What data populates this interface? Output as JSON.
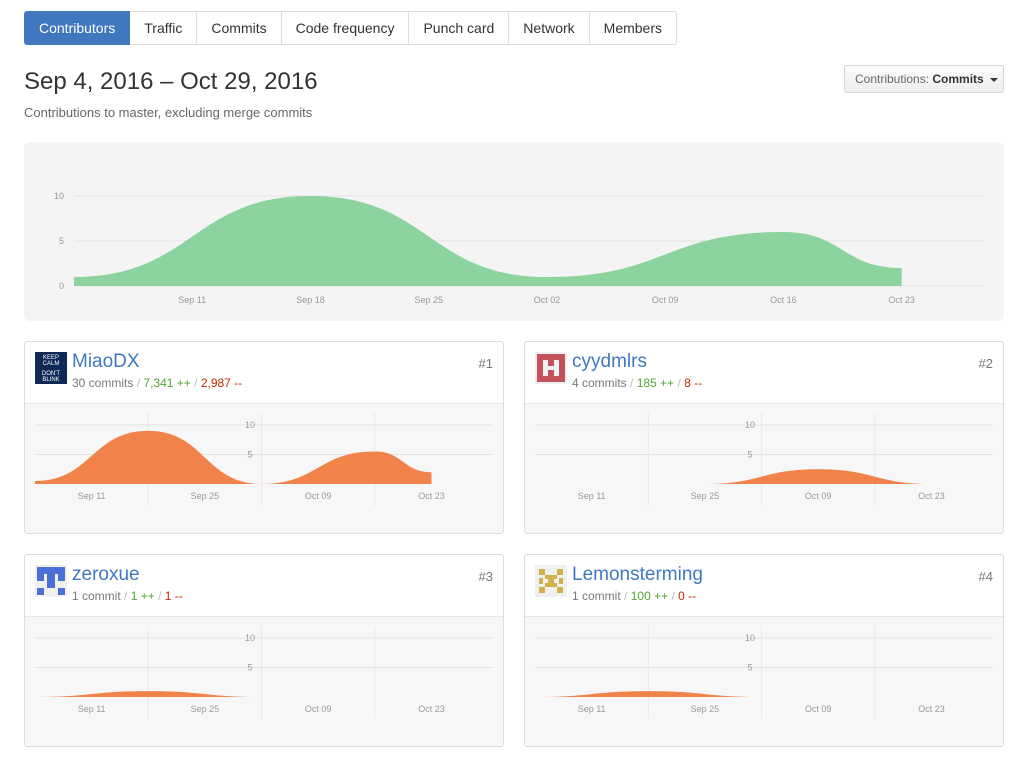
{
  "tabs": [
    {
      "label": "Contributors",
      "selected": true
    },
    {
      "label": "Traffic",
      "selected": false
    },
    {
      "label": "Commits",
      "selected": false
    },
    {
      "label": "Code frequency",
      "selected": false
    },
    {
      "label": "Punch card",
      "selected": false
    },
    {
      "label": "Network",
      "selected": false
    },
    {
      "label": "Members",
      "selected": false
    }
  ],
  "header": {
    "date_range": "Sep 4, 2016 – Oct 29, 2016",
    "subtitle": "Contributions to master, excluding merge commits"
  },
  "dropdown": {
    "prefix": "Contributions:",
    "value": "Commits"
  },
  "colors": {
    "main_area": "#8cd3a0",
    "user_area": "#f1834a",
    "link": "#4078c0",
    "additions": "#55a532",
    "deletions": "#bd2c00"
  },
  "main_chart_data": {
    "type": "area",
    "x": [
      "2016-09-04",
      "2016-09-18",
      "2016-10-02",
      "2016-10-16",
      "2016-10-23"
    ],
    "y": [
      1,
      10,
      1,
      6,
      2
    ],
    "ylim": [
      0,
      10
    ],
    "y_ticks": [
      "0",
      "5",
      "10"
    ],
    "x_ticks": [
      "Sep 11",
      "Sep 18",
      "Sep 25",
      "Oct 02",
      "Oct 09",
      "Oct 16",
      "Oct 23"
    ]
  },
  "contributors": [
    {
      "name": "MiaoDX",
      "rank": "#1",
      "commits": "30 commits",
      "additions": "7,341 ++",
      "deletions": "2,987 --",
      "avatar": "keep-calm-dont-blink-icon",
      "avatar_text": [
        "KEEP",
        "CALM",
        "DON'T",
        "BLINK"
      ],
      "chart_data": {
        "type": "area",
        "x": [
          "2016-09-04",
          "2016-09-18",
          "2016-10-02",
          "2016-10-16",
          "2016-10-23"
        ],
        "y": [
          0.5,
          9,
          0,
          5.5,
          2
        ],
        "ylim": [
          0,
          10
        ],
        "y_ticks": [
          "5",
          "10"
        ],
        "x_ticks": [
          "Sep 11",
          "Sep 25",
          "Oct 09",
          "Oct 23"
        ]
      }
    },
    {
      "name": "cyydmlrs",
      "rank": "#2",
      "commits": "4 commits",
      "additions": "185 ++",
      "deletions": "8 --",
      "avatar": "identicon-red",
      "chart_data": {
        "type": "area",
        "x": [
          "2016-09-25",
          "2016-10-09",
          "2016-10-23"
        ],
        "y": [
          0,
          2.5,
          0
        ],
        "ylim": [
          0,
          10
        ],
        "y_ticks": [
          "5",
          "10"
        ],
        "x_ticks": [
          "Sep 11",
          "Sep 25",
          "Oct 09",
          "Oct 23"
        ]
      }
    },
    {
      "name": "zeroxue",
      "rank": "#3",
      "commits": "1 commit",
      "additions": "1 ++",
      "deletions": "1 --",
      "avatar": "identicon-blue",
      "chart_data": {
        "type": "area",
        "x": [
          "2016-09-04",
          "2016-09-18",
          "2016-10-02"
        ],
        "y": [
          0,
          1,
          0
        ],
        "ylim": [
          0,
          10
        ],
        "y_ticks": [
          "5",
          "10"
        ],
        "x_ticks": [
          "Sep 11",
          "Sep 25",
          "Oct 09",
          "Oct 23"
        ]
      }
    },
    {
      "name": "Lemonsterming",
      "rank": "#4",
      "commits": "1 commit",
      "additions": "100 ++",
      "deletions": "0 --",
      "avatar": "identicon-gold",
      "chart_data": {
        "type": "area",
        "x": [
          "2016-09-04",
          "2016-09-18",
          "2016-10-02"
        ],
        "y": [
          0,
          1,
          0
        ],
        "ylim": [
          0,
          10
        ],
        "y_ticks": [
          "5",
          "10"
        ],
        "x_ticks": [
          "Sep 11",
          "Sep 25",
          "Oct 09",
          "Oct 23"
        ]
      }
    }
  ]
}
